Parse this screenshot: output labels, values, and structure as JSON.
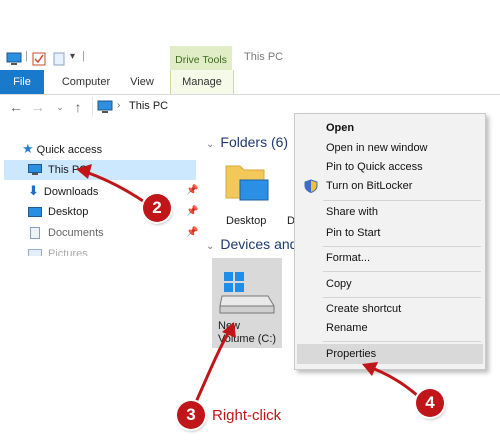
{
  "window": {
    "title": "This PC"
  },
  "ribbon": {
    "tabs": [
      {
        "label": "File"
      },
      {
        "label": "Computer"
      },
      {
        "label": "View"
      },
      {
        "label": "Manage"
      }
    ],
    "context_tab": "Drive Tools"
  },
  "address_bar": {
    "path": "This PC"
  },
  "nav_pane": {
    "items": [
      {
        "label": "Quick access",
        "icon": "star-icon"
      },
      {
        "label": "This PC",
        "icon": "computer-icon",
        "selected": true
      },
      {
        "label": "Downloads",
        "icon": "download-icon"
      },
      {
        "label": "Desktop",
        "icon": "desktop-icon"
      },
      {
        "label": "Documents",
        "icon": "document-icon"
      },
      {
        "label": "Pictures",
        "icon": "picture-icon"
      }
    ]
  },
  "content": {
    "folders_header": "Folders (6)",
    "folder_labels": [
      "Desktop",
      "D"
    ],
    "devices_header": "Devices and",
    "drive_label_line1": "New",
    "drive_label_line2": "Volume (C:)"
  },
  "context_menu": {
    "items": [
      "Open",
      "Open in new window",
      "Pin to Quick access",
      "Turn on BitLocker",
      "Share with",
      "Pin to Start",
      "Format...",
      "Copy",
      "Create shortcut",
      "Rename",
      "Properties"
    ]
  },
  "annotations": {
    "step2": "2",
    "step3": "3",
    "step3_text": "Right-click",
    "step4": "4"
  },
  "colors": {
    "file_tab": "#1979ca",
    "selection": "#cce8ff",
    "badge_red": "#c0161a",
    "drive_tools_tab": "#e0edc6"
  }
}
